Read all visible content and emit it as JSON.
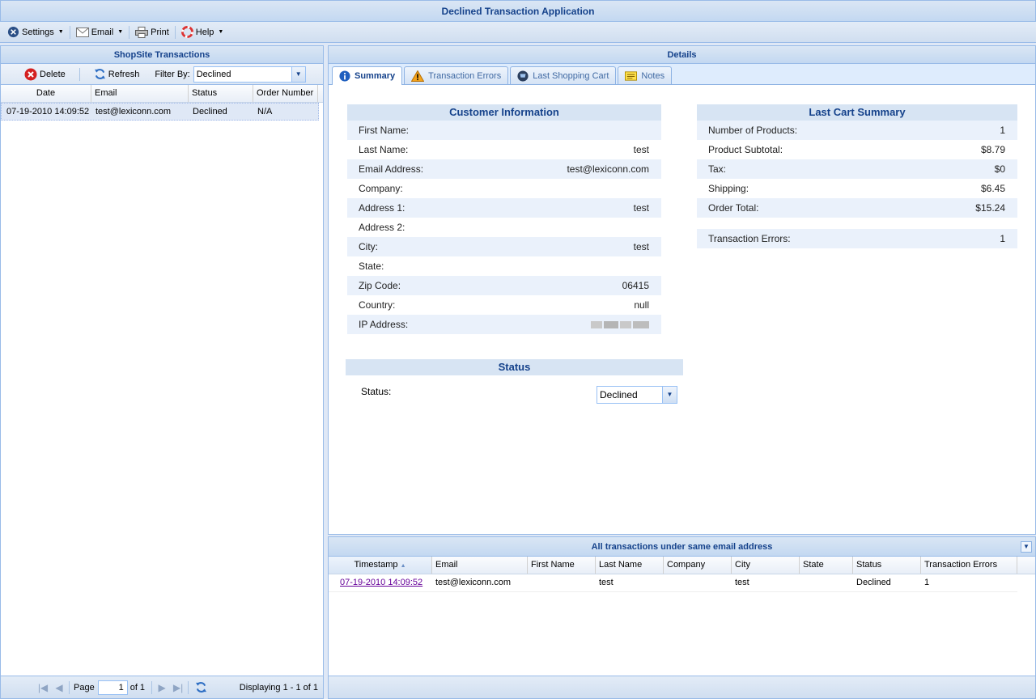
{
  "app": {
    "title": "Declined Transaction Application"
  },
  "toolbar": {
    "settings": "Settings",
    "email": "Email",
    "print": "Print",
    "help": "Help"
  },
  "left": {
    "title": "ShopSite Transactions",
    "delete": "Delete",
    "refresh": "Refresh",
    "filter_label": "Filter By:",
    "filter_value": "Declined",
    "columns": [
      "Date",
      "Email",
      "Status",
      "Order Number"
    ],
    "rows": [
      {
        "date": "07-19-2010 14:09:52",
        "email": "test@lexiconn.com",
        "status": "Declined",
        "order": "N/A"
      }
    ],
    "paging": {
      "page_label": "Page",
      "page": "1",
      "of": "of 1",
      "displaying": "Displaying 1 - 1 of 1"
    }
  },
  "details": {
    "title": "Details",
    "tabs": [
      "Summary",
      "Transaction Errors",
      "Last Shopping Cart",
      "Notes"
    ],
    "customer": {
      "heading": "Customer Information",
      "fields": [
        {
          "label": "First Name:",
          "value": ""
        },
        {
          "label": "Last Name:",
          "value": "test"
        },
        {
          "label": "Email Address:",
          "value": "test@lexiconn.com"
        },
        {
          "label": "Company:",
          "value": ""
        },
        {
          "label": "Address 1:",
          "value": "test"
        },
        {
          "label": "Address 2:",
          "value": ""
        },
        {
          "label": "City:",
          "value": "test"
        },
        {
          "label": "State:",
          "value": ""
        },
        {
          "label": "Zip Code:",
          "value": "06415"
        },
        {
          "label": "Country:",
          "value": "null"
        },
        {
          "label": "IP Address:",
          "value": ""
        }
      ]
    },
    "cart": {
      "heading": "Last Cart Summary",
      "fields": [
        {
          "label": "Number of Products:",
          "value": "1"
        },
        {
          "label": "Product Subtotal:",
          "value": "$8.79"
        },
        {
          "label": "Tax:",
          "value": "$0"
        },
        {
          "label": "Shipping:",
          "value": "$6.45"
        },
        {
          "label": "Order Total:",
          "value": "$15.24"
        }
      ],
      "errors_label": "Transaction Errors:",
      "errors_value": "1"
    },
    "status": {
      "heading": "Status",
      "label": "Status:",
      "value": "Declined"
    }
  },
  "email_grid": {
    "title": "All transactions under same email address",
    "columns": [
      "Timestamp",
      "Email",
      "First Name",
      "Last Name",
      "Company",
      "City",
      "State",
      "Status",
      "Transaction Errors"
    ],
    "rows": [
      {
        "timestamp": "07-19-2010 14:09:52",
        "email": "test@lexiconn.com",
        "first": "",
        "last": "test",
        "company": "",
        "city": "test",
        "state": "",
        "status": "Declined",
        "errors": "1"
      }
    ]
  }
}
